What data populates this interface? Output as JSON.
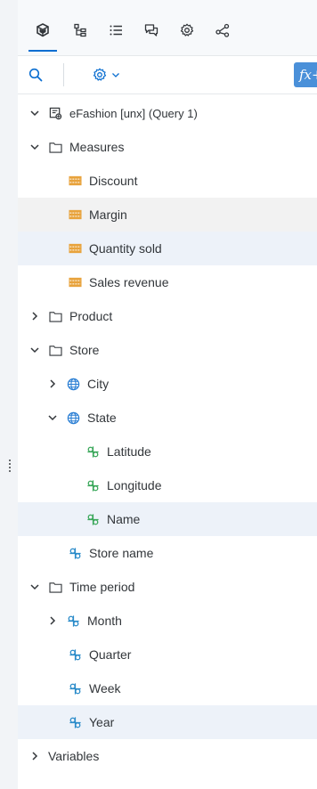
{
  "tabs": [
    {
      "icon": "cube-icon",
      "name": "Objects"
    },
    {
      "icon": "hierarchy-icon",
      "name": "Structure"
    },
    {
      "icon": "list-icon",
      "name": "List"
    },
    {
      "icon": "comments-icon",
      "name": "Comments"
    },
    {
      "icon": "settings-icon",
      "name": "Settings"
    },
    {
      "icon": "share-icon",
      "name": "Share"
    }
  ],
  "toolbar": {
    "search_icon": "search-icon",
    "settings_icon": "settings-icon",
    "dropdown_icon": "chevron-down-icon",
    "fx_label": "fx+"
  },
  "tree": {
    "query": "eFashion [unx] (Query 1)",
    "measures": {
      "label": "Measures",
      "items": [
        "Discount",
        "Margin",
        "Quantity sold",
        "Sales revenue"
      ]
    },
    "product": "Product",
    "store": {
      "label": "Store",
      "city": "City",
      "state": {
        "label": "State",
        "items": [
          "Latitude",
          "Longitude",
          "Name"
        ]
      },
      "store_name": "Store name"
    },
    "time_period": {
      "label": "Time period",
      "month": "Month",
      "items": [
        "Quarter",
        "Week",
        "Year"
      ]
    },
    "variables": "Variables"
  },
  "colors": {
    "accent": "#0a6ed1",
    "measure": "#e8a33d",
    "dimension": "#2a8bc9",
    "geo": "#2b7fd4",
    "attribute": "#3aa75a",
    "highlight": "#edf2f9",
    "hover": "#f2f2f2"
  }
}
